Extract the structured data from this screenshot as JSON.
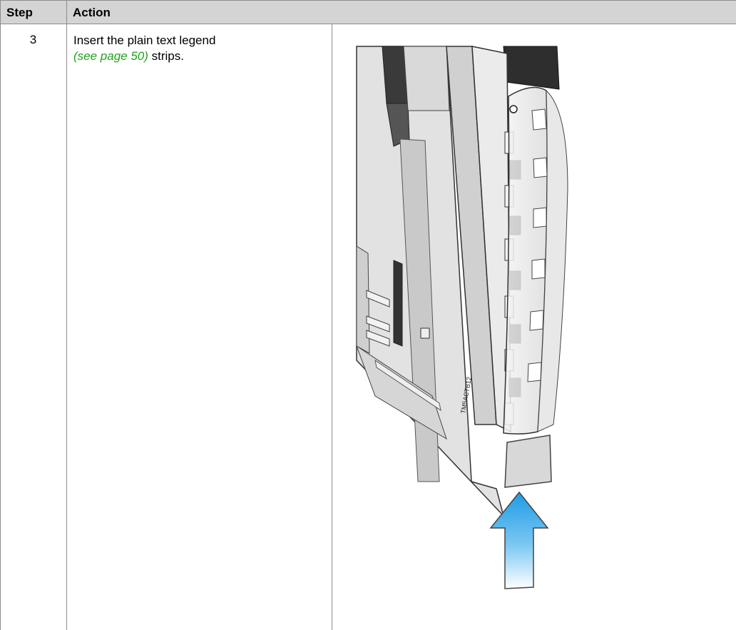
{
  "table": {
    "headers": {
      "step": "Step",
      "action": "Action"
    },
    "row": {
      "step": "3",
      "text_before": "Insert the plain text legend",
      "link_text": "(see page 50)",
      "text_after": " strips."
    }
  },
  "illustration": {
    "module_label": "TM5ACTB12",
    "arrow_color": "#1e9be6",
    "arrow_direction": "up"
  }
}
